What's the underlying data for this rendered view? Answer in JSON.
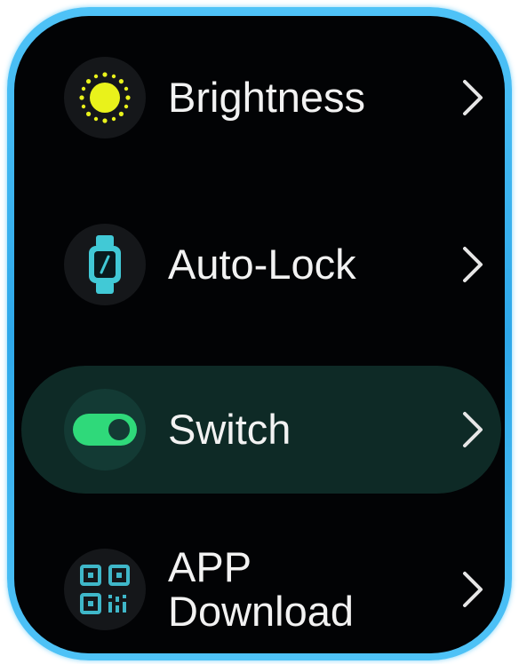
{
  "menu": {
    "items": [
      {
        "label": "Brightness",
        "icon": "sun-icon"
      },
      {
        "label": "Auto-Lock",
        "icon": "watch-icon"
      },
      {
        "label": "Switch",
        "icon": "toggle-icon",
        "selected": true
      },
      {
        "label": "APP Download",
        "icon": "qr-code-icon"
      }
    ]
  },
  "colors": {
    "frame": "#4fc3f7",
    "screen_bg": "#020305",
    "selected_row_bg": "#0e2a26",
    "sun_yellow": "#e9f21b",
    "watch_cyan": "#41c9d6",
    "toggle_green": "#2fd97a",
    "qr_cyan": "#3fb7c9",
    "text": "#f2f2f2"
  }
}
